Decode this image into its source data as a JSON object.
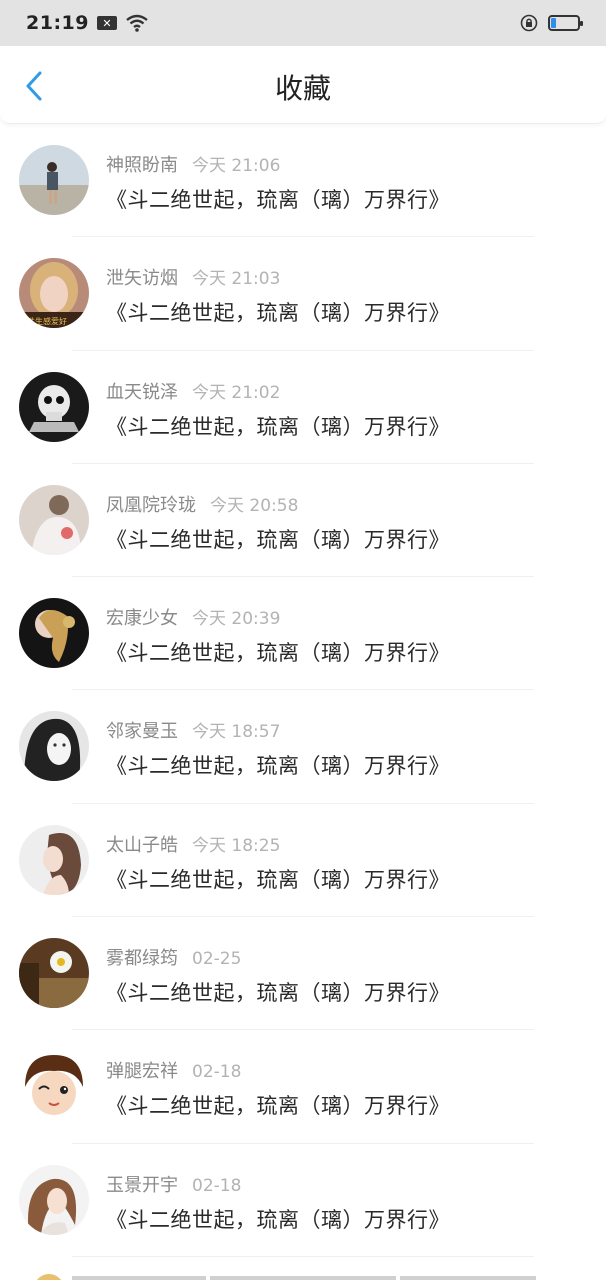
{
  "status_bar": {
    "time": "21:19",
    "battery_level": 0.18,
    "accent_color": "#2f8fe8"
  },
  "header": {
    "back_icon": "chevron-left-icon",
    "title": "收藏",
    "back_color": "#2e9be6"
  },
  "items": [
    {
      "user": "神照盼南",
      "time": "今天 21:06",
      "title": "《斗二绝世起，琉离（璃）万界行》",
      "avatar": "beach-girl"
    },
    {
      "user": "泄矢访烟",
      "time": "今天 21:03",
      "title": "《斗二绝世起，琉离（璃）万界行》",
      "avatar": "blonde-girl"
    },
    {
      "user": "血天锐泽",
      "time": "今天 21:02",
      "title": "《斗二绝世起，琉离（璃）万界行》",
      "avatar": "skull"
    },
    {
      "user": "凤凰院玲珑",
      "time": "今天 20:58",
      "title": "《斗二绝世起，琉离（璃）万界行》",
      "avatar": "anime-white"
    },
    {
      "user": "宏康少女",
      "time": "今天 20:39",
      "title": "《斗二绝世起，琉离（璃）万界行》",
      "avatar": "braid-girl"
    },
    {
      "user": "邻家曼玉",
      "time": "今天 18:57",
      "title": "《斗二绝世起，琉离（璃）万界行》",
      "avatar": "bw-girl"
    },
    {
      "user": "太山子皓",
      "time": "今天 18:25",
      "title": "《斗二绝世起，琉离（璃）万界行》",
      "avatar": "profile-girl"
    },
    {
      "user": "雾都绿筠",
      "time": "02-25",
      "title": "《斗二绝世起，琉离（璃）万界行》",
      "avatar": "daisy"
    },
    {
      "user": "弹腿宏祥",
      "time": "02-18",
      "title": "《斗二绝世起，琉离（璃）万界行》",
      "avatar": "cartoon-boy"
    },
    {
      "user": "玉景开宇",
      "time": "02-18",
      "title": "《斗二绝世起，琉离（璃）万界行》",
      "avatar": "curly-girl"
    }
  ]
}
